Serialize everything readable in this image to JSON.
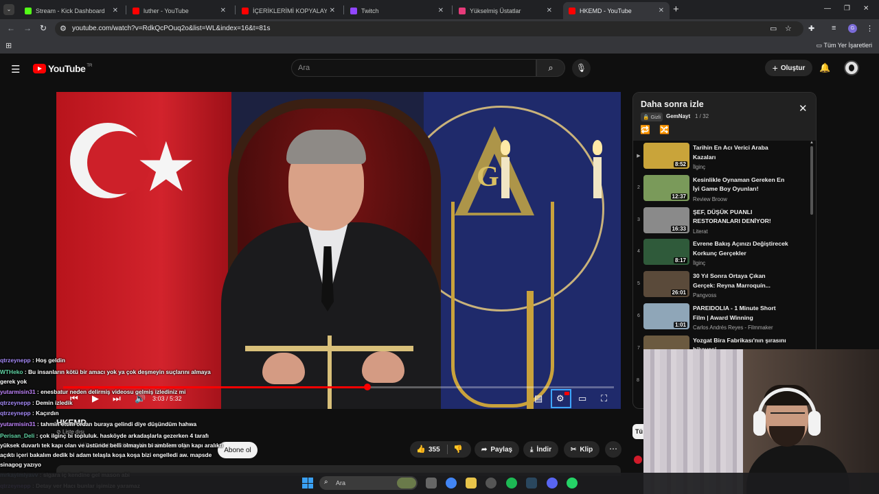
{
  "browser": {
    "tabs": [
      {
        "title": "Stream - Kick Dashboard",
        "color": "#53fc18",
        "glyph": "K"
      },
      {
        "title": "luther - YouTube",
        "color": "#ff0000",
        "glyph": "▶"
      },
      {
        "title": "İÇERİKLERİMİ KOPYALAYAN KA",
        "color": "#ff0000",
        "glyph": "▶"
      },
      {
        "title": "Twitch",
        "color": "#9146ff",
        "glyph": "t"
      },
      {
        "title": "Yükselmiş Üstatlar",
        "color": "#e63b7a",
        "glyph": "◆"
      },
      {
        "title": "HKEMD - YouTube",
        "color": "#ff0000",
        "glyph": "▶"
      }
    ],
    "url": "youtube.com/watch?v=RdkQcPOuq2o&list=WL&index=16&t=81s",
    "bookmarks_label": "Tüm Yer İşaretleri"
  },
  "youtube": {
    "logo_text": "YouTube",
    "country_code": "TR",
    "search_placeholder": "Ara",
    "create_label": "Oluştur"
  },
  "player": {
    "current_time": "3:03",
    "duration": "5:32",
    "time_display": "3:03 / 5:32",
    "progress_fraction": 0.552
  },
  "video_info": {
    "channel_name": "HKEMD",
    "visibility": "Liste dışı",
    "ghost_title": "Hür ve Kabul Edilmiş Masonlar Derneği",
    "subscribe_label": "Abone ol",
    "like_count": "355",
    "share_label": "Paylaş",
    "download_label": "İndir",
    "clip_label": "Klip"
  },
  "playlist": {
    "title": "Daha sonra izle",
    "privacy": "Gizli",
    "owner": "GemNayt",
    "position": "1 / 32",
    "items": [
      {
        "index": "▶",
        "title": "Tarihin En Acı Verici Araba Kazaları",
        "channel": "İlginç",
        "duration": "8:52",
        "thumb": "#c9a43a"
      },
      {
        "index": "2",
        "title": "Kesinlikle Oynaman Gereken En İyi Game Boy Oyunları!",
        "channel": "Review Broow",
        "duration": "12:37",
        "thumb": "#7a9a5a"
      },
      {
        "index": "3",
        "title": "ŞEF, DÜŞÜK PUANLI RESTORANLARI DENİYOR!",
        "channel": "Literat",
        "duration": "16:33",
        "thumb": "#8a8a8a"
      },
      {
        "index": "4",
        "title": "Evrene Bakış Açınızı Değiştirecek Korkunç Gerçekler",
        "channel": "İlginç",
        "duration": "8:17",
        "thumb": "#2f5a3a"
      },
      {
        "index": "5",
        "title": "30 Yıl Sonra Ortaya Çıkan Gerçek: Reyna Marroquín...",
        "channel": "Pangvoss",
        "duration": "26:01",
        "thumb": "#5a4a3a"
      },
      {
        "index": "6",
        "title": "PAREIDOLIA - 1 Minute Short Film | Award Winning",
        "channel": "Carlos Andrés Reyes - Filmmaker",
        "duration": "1:01",
        "thumb": "#8fa6b8"
      },
      {
        "index": "7",
        "title": "Yozgat Bira Fabrikası'nın şırasını hikayesi",
        "channel": "",
        "duration": "",
        "thumb": "#6b5a40"
      }
    ],
    "hidden_index": "8"
  },
  "chat": [
    {
      "user": "qtrzeynepp",
      "color": "#a78bfa",
      "text": "Hoş geldin"
    },
    {
      "user": "WTHeko",
      "color": "#60d4a4",
      "text": "Bu insanların kötü bir amacı yok ya çok deşmeyin suçlarını almaya gerek yok"
    },
    {
      "user": "yutarmisin31",
      "color": "#c084fc",
      "text": "enesbatur neden delirmiş videosu gelmiş izlediniz mi"
    },
    {
      "user": "qtrzeynepp",
      "color": "#a78bfa",
      "text": "Demin izledik"
    },
    {
      "user": "qtrzeynepp",
      "color": "#a78bfa",
      "text": "Kaçırdın"
    },
    {
      "user": "yutarmisin31",
      "color": "#c084fc",
      "text": "tahmin ettim ordan buraya gelindi diye düşündüm hahwa"
    },
    {
      "user": "Perisan_Deli",
      "color": "#60d4a4",
      "text": "çok ilginç bi topluluk. hasköyde arkadaşlarla gezerken 4 tarafı yüksek duvarlı tek kapı olan ve üstünde belli olmayan bi amblem olan kapı aralıktı açıktı içeri bakalım dedik bi adam telaşla koşa koşa bizi engelledi aw. mapsde sinagog yazıyo"
    },
    {
      "user": "mrkayimiyavv",
      "color": "#93c5fd",
      "text": "sigara iç kendine gel mason abi"
    },
    {
      "user": "qtrzeynepp",
      "color": "#a78bfa",
      "text": "Detay ver Hacı bunlar işimize yaramaz"
    }
  ],
  "taskbar": {
    "search_label": "Ara"
  }
}
